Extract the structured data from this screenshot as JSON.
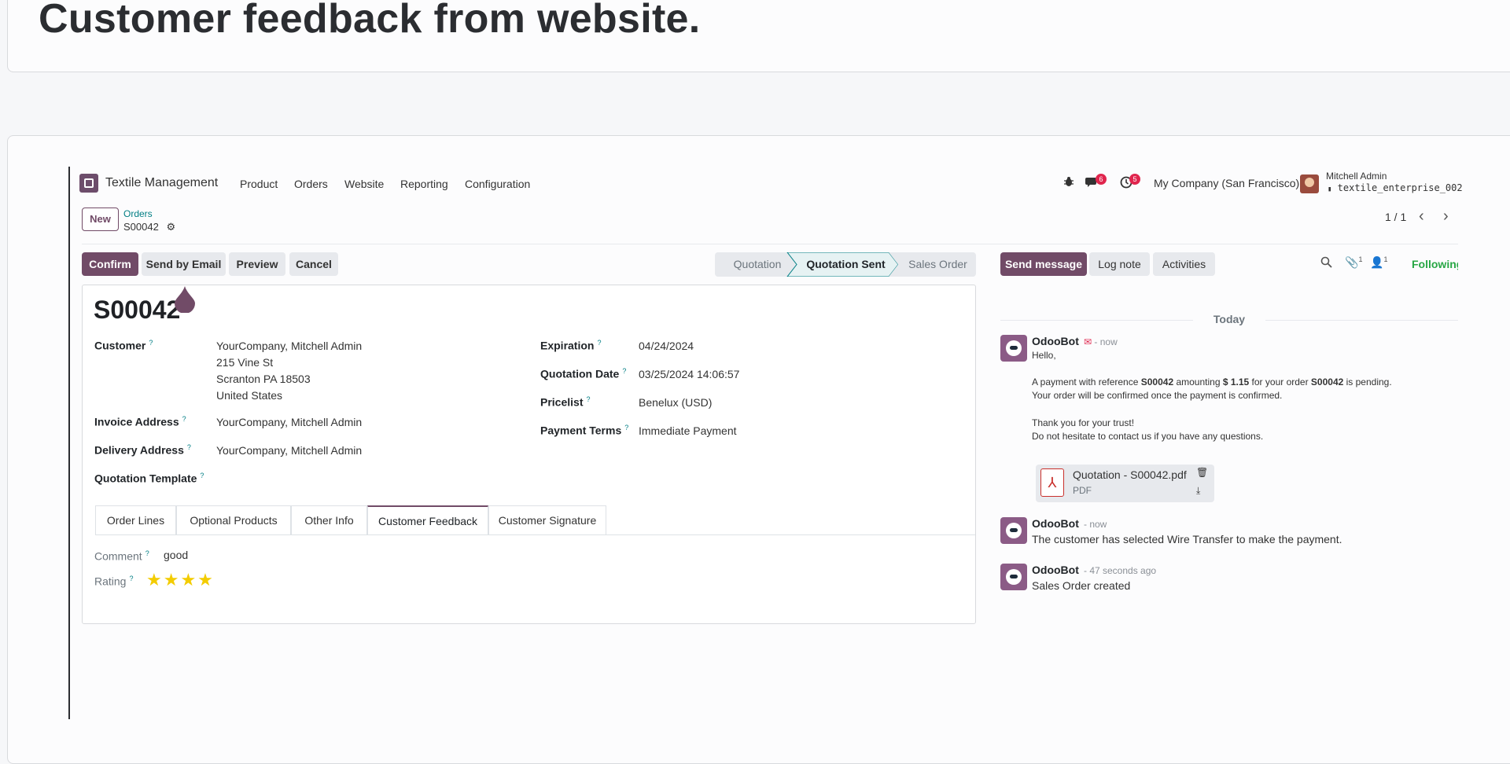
{
  "page_title": "Customer feedback from website.",
  "navbar": {
    "app_name": "Textile Management",
    "menu": [
      "Product",
      "Orders",
      "Website",
      "Reporting",
      "Configuration"
    ],
    "messages_count": "6",
    "activities_count": "5",
    "company": "My Company (San Francisco)",
    "user_name": "Mitchell Admin",
    "database": "textile_enterprise_002"
  },
  "control_panel": {
    "new_label": "New",
    "breadcrumb_parent": "Orders",
    "breadcrumb_current": "S00042",
    "pager": "1 / 1"
  },
  "actions": {
    "confirm": "Confirm",
    "send_by_email": "Send by Email",
    "preview": "Preview",
    "cancel": "Cancel"
  },
  "statusbar": {
    "stages": [
      "Quotation",
      "Quotation Sent",
      "Sales Order"
    ],
    "active": "Quotation Sent"
  },
  "record": {
    "name": "S00042",
    "customer_label": "Customer",
    "customer_lines": [
      "YourCompany, Mitchell Admin",
      "215 Vine St",
      "Scranton PA 18503",
      "United States"
    ],
    "invoice_address_label": "Invoice Address",
    "invoice_address": "YourCompany, Mitchell Admin",
    "delivery_address_label": "Delivery Address",
    "delivery_address": "YourCompany, Mitchell Admin",
    "quotation_template_label": "Quotation Template",
    "expiration_label": "Expiration",
    "expiration": "04/24/2024",
    "quotation_date_label": "Quotation Date",
    "quotation_date": "03/25/2024 14:06:57",
    "pricelist_label": "Pricelist",
    "pricelist": "Benelux (USD)",
    "payment_terms_label": "Payment Terms",
    "payment_terms": "Immediate Payment",
    "help_mark": "?"
  },
  "tabs": [
    "Order Lines",
    "Optional Products",
    "Other Info",
    "Customer Feedback",
    "Customer Signature"
  ],
  "active_tab": "Customer Feedback",
  "feedback": {
    "comment_label": "Comment",
    "comment": "good",
    "rating_label": "Rating",
    "rating": 4,
    "stars": "★★★★"
  },
  "chatter": {
    "send_message": "Send message",
    "log_note": "Log note",
    "activities": "Activities",
    "attachments_count": "1",
    "followers_count": "1",
    "following": "Following",
    "today": "Today",
    "messages": [
      {
        "author": "OdooBot",
        "time": "- now",
        "lines": [
          "Hello,"
        ],
        "payment_pre": "A payment with reference ",
        "payment_ref": "S00042",
        "payment_mid": " amounting ",
        "payment_amount": "$ 1.15",
        "payment_mid2": " for your order ",
        "payment_order": "S00042",
        "payment_post": " is pending.",
        "line_confirm": "Your order will be confirmed once the payment is confirmed.",
        "line_thanks": "Thank you for your trust!",
        "line_contact": "Do not hesitate to contact us if you have any questions.",
        "attachment_name": "Quotation - S00042.pdf",
        "attachment_type": "PDF"
      },
      {
        "author": "OdooBot",
        "time": "- now",
        "body": "The customer has selected Wire Transfer to make the payment."
      },
      {
        "author": "OdooBot",
        "time": "- 47 seconds ago",
        "body": "Sales Order created"
      }
    ]
  },
  "colors": {
    "brand": "#714b67",
    "link": "#017e84",
    "badge": "#e0254d",
    "star": "#f3cc00",
    "following": "#28a745"
  }
}
